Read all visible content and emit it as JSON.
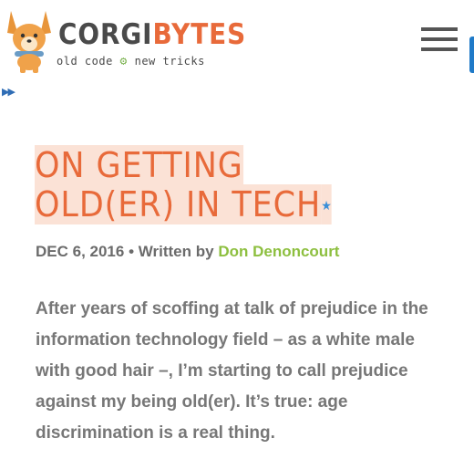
{
  "header": {
    "brand_part1": "CORGI",
    "brand_part2": "BYTES",
    "tagline_left": "old code",
    "tagline_right": "new tricks",
    "menu_icon": "hamburger-icon"
  },
  "article": {
    "title": "ON GETTING OLD(ER) IN TECH",
    "date": "DEC 6, 2016",
    "written_by": "Written by",
    "author": "Don Denoncourt",
    "excerpt": "After years of scoffing at talk of prejudice in the information technology field – as a white male with good hair –, I’m starting to call prejudice against my being old(er). It’s true: age discrimination is a real thing."
  },
  "colors": {
    "accent": "#e86a3a",
    "author_link": "#8dbf3f",
    "title_highlight": "#fbe2d6",
    "side_tab": "#1f7ac8"
  }
}
